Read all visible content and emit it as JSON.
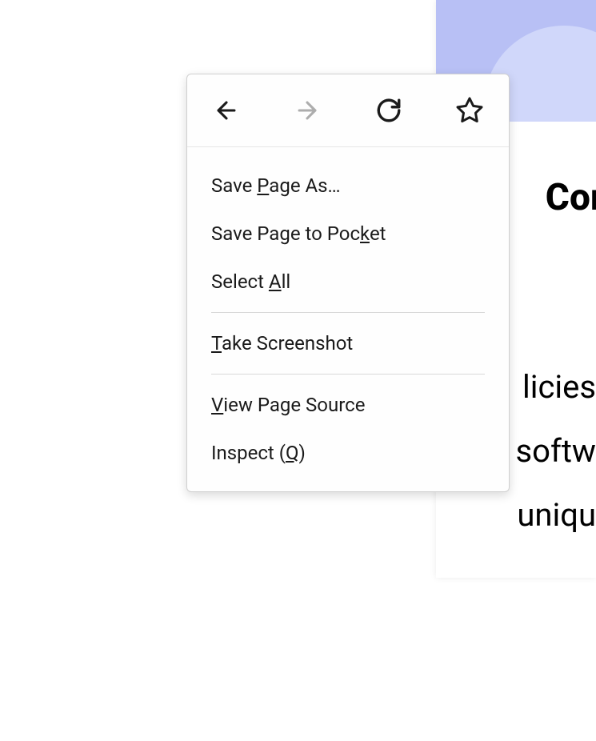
{
  "background": {
    "heading": "Cor",
    "line1": "licies",
    "line2": "softw",
    "line3": "uniqu"
  },
  "contextMenu": {
    "toolbar": {
      "back": "back",
      "forward": "forward",
      "reload": "reload",
      "bookmark": "bookmark"
    },
    "items": [
      {
        "parts": [
          "Save ",
          "P",
          "age As…"
        ],
        "underlineIndex": 1
      },
      {
        "parts": [
          "Save Page to Poc",
          "k",
          "et"
        ],
        "underlineIndex": 1
      },
      {
        "parts": [
          "Select ",
          "A",
          "ll"
        ],
        "underlineIndex": 1
      },
      {
        "separator": true
      },
      {
        "parts": [
          "T",
          "ake Screenshot"
        ],
        "underlineIndex": 0
      },
      {
        "separator": true
      },
      {
        "parts": [
          "V",
          "iew Page Source"
        ],
        "underlineIndex": 0
      },
      {
        "parts": [
          "Inspect (",
          "Q",
          ")"
        ],
        "underlineIndex": 1
      }
    ]
  }
}
